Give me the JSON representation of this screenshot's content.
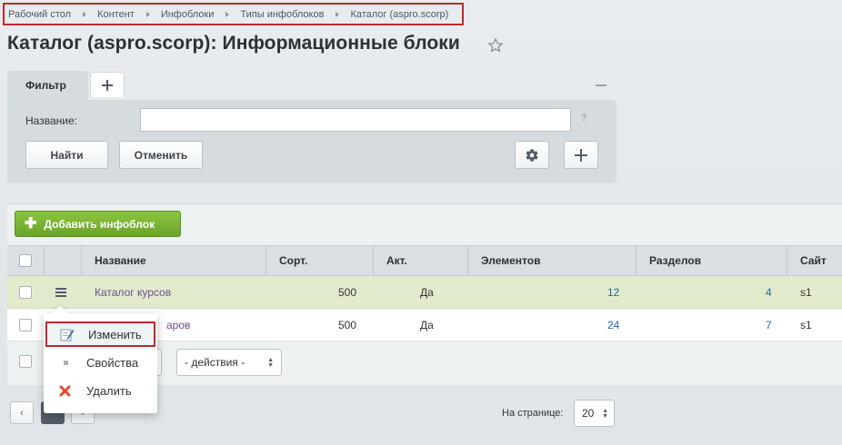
{
  "breadcrumb": [
    "Рабочий стол",
    "Контент",
    "Инфоблоки",
    "Типы инфоблоков",
    "Каталог (aspro.scorp)"
  ],
  "page_title": "Каталог (aspro.scorp): Информационные блоки",
  "filter": {
    "tab_label": "Фильтр",
    "name_label": "Название:",
    "name_value": "",
    "help": "?",
    "find_label": "Найти",
    "cancel_label": "Отменить"
  },
  "toolbar": {
    "add_label": "Добавить инфоблок"
  },
  "table": {
    "columns": [
      "Название",
      "Сорт.",
      "Акт.",
      "Элементов",
      "Разделов",
      "Сайт"
    ],
    "rows": [
      {
        "name": "Каталог курсов",
        "sort": "500",
        "active": "Да",
        "elements": "12",
        "sections": "4",
        "site": "s1"
      },
      {
        "name": "Каталог товаров",
        "name_visible": "аров",
        "sort": "500",
        "active": "Да",
        "elements": "24",
        "sections": "7",
        "site": "s1"
      }
    ]
  },
  "context_menu": {
    "items": [
      {
        "label": "Изменить",
        "icon": "edit-icon"
      },
      {
        "label": "Свойства",
        "icon": "properties-icon"
      },
      {
        "label": "Удалить",
        "icon": "delete-icon"
      }
    ]
  },
  "actions_select": "- действия -",
  "pager": {
    "per_page_label": "На странице:",
    "per_page_value": "20"
  },
  "colors": {
    "accent_red": "#c0282d",
    "add_button_green": "#7ab334",
    "link": "#6b4f8f",
    "number_link": "#2067b0"
  }
}
